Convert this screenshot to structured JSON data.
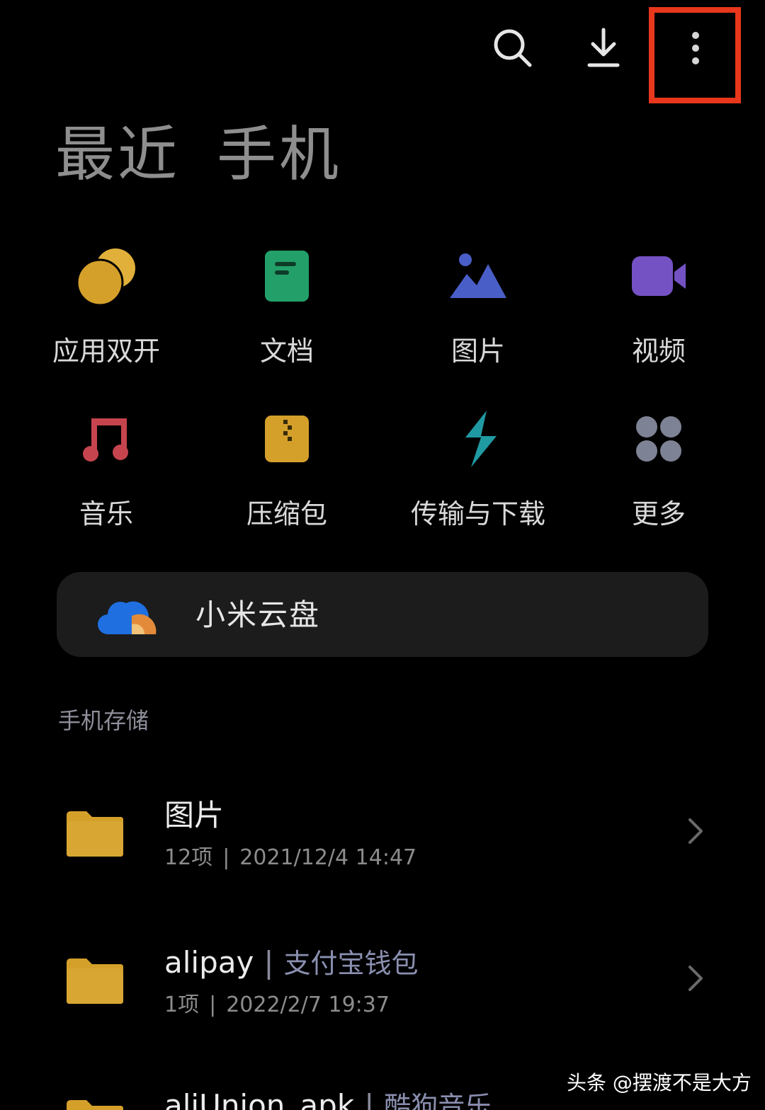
{
  "toolbar": {
    "search_icon": "search-icon",
    "download_icon": "download-icon",
    "more_icon": "more-vertical-icon",
    "highlight_color": "#e8371c"
  },
  "tabs": [
    {
      "label": "最近",
      "active": false
    },
    {
      "label": "手机",
      "active": true
    }
  ],
  "categories": [
    {
      "label": "应用双开",
      "icon": "dual-app-icon",
      "color": "#d4a02a"
    },
    {
      "label": "文档",
      "icon": "document-icon",
      "color": "#23a06a"
    },
    {
      "label": "图片",
      "icon": "image-icon",
      "color": "#4a5ec8"
    },
    {
      "label": "视频",
      "icon": "video-icon",
      "color": "#7452c4"
    },
    {
      "label": "音乐",
      "icon": "music-icon",
      "color": "#c6444e"
    },
    {
      "label": "压缩包",
      "icon": "archive-icon",
      "color": "#d4a02a"
    },
    {
      "label": "传输与下载",
      "icon": "transfer-icon",
      "color": "#1f9aa2"
    },
    {
      "label": "更多",
      "icon": "more-grid-icon",
      "color": "#7d8294"
    }
  ],
  "cloud": {
    "label": "小米云盘",
    "icon": "cloud-drive-icon"
  },
  "storage": {
    "section_title": "手机存储",
    "items": [
      {
        "name": "图片",
        "alias": "",
        "count": "12项",
        "date": "2021/12/4 14:47"
      },
      {
        "name": "alipay",
        "alias": "支付宝钱包",
        "count": "1项",
        "date": "2022/2/7 19:37"
      },
      {
        "name": "aliUnion_apk",
        "alias": "酷狗音乐",
        "count": "",
        "date": ""
      }
    ]
  },
  "watermark": "头条 @摆渡不是大方"
}
